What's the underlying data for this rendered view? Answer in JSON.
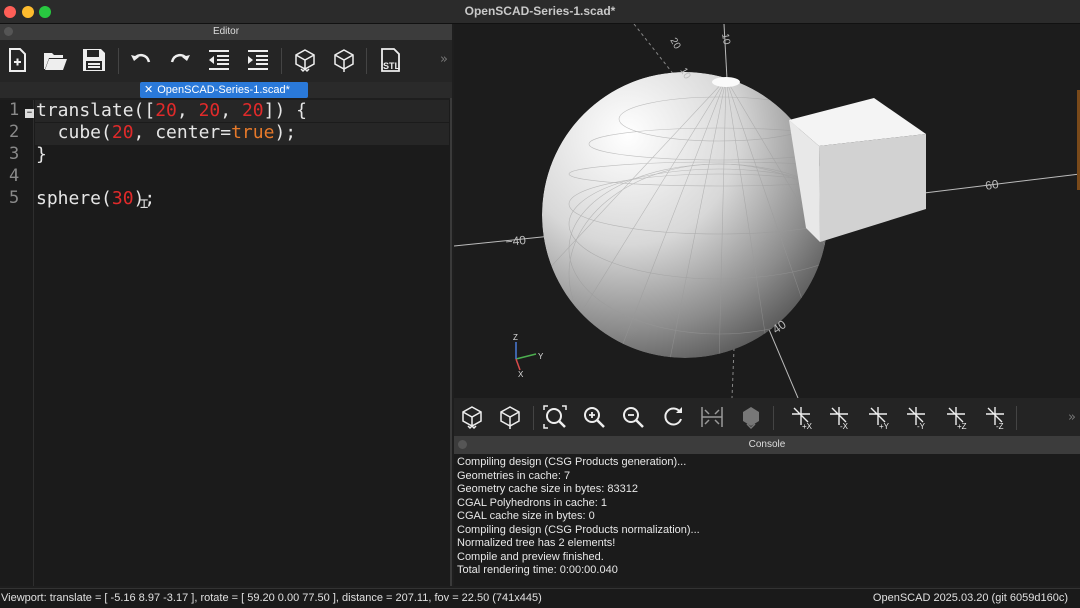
{
  "window": {
    "title": "OpenSCAD-Series-1.scad*"
  },
  "editor": {
    "header": "Editor",
    "tab_label": "OpenSCAD-Series-1.scad*",
    "more_glyph": "»",
    "toolbar_icons": [
      "new-file-icon",
      "open-file-icon",
      "save-icon",
      "undo-icon",
      "redo-icon",
      "unindent-icon",
      "indent-icon",
      "preview-icon",
      "render-icon",
      "export-stl-icon"
    ],
    "line_numbers": [
      "1",
      "2",
      "3",
      "4",
      "5"
    ]
  },
  "code": {
    "line1": {
      "a": "translate([",
      "n1": "20",
      "c1": ", ",
      "n2": "20",
      "c2": ", ",
      "n3": "20",
      "b": "]) {"
    },
    "line2": {
      "a": "  cube(",
      "n1": "20",
      "c1": ", center=",
      "kw": "true",
      "b": ");"
    },
    "line3": "}",
    "line5": {
      "a": "sphere(",
      "n1": "30",
      "b": ");"
    }
  },
  "viewport": {
    "axis_labels": [
      "60",
      "40",
      "40",
      "20",
      "10",
      "10"
    ],
    "neg_label": "−40",
    "gizmo": {
      "x": "X",
      "y": "Y",
      "z": "Z"
    }
  },
  "view_toolbar": {
    "icons": [
      "preview-icon",
      "render-icon",
      "view-all-icon",
      "zoom-in-icon",
      "zoom-out-icon",
      "reset-view-icon",
      "perspective-icon",
      "orthogonal-icon",
      "view-right-icon",
      "view-left-icon",
      "view-top-icon",
      "view-bottom-icon",
      "view-front-icon",
      "view-back-icon"
    ],
    "view_labels": [
      "+X",
      "-X",
      "+Y",
      "-Y",
      "+Z",
      "-Z"
    ],
    "more_glyph": "»"
  },
  "console": {
    "header": "Console",
    "lines": [
      "Compiling design (CSG Products generation)...",
      "Geometries in cache: 7",
      "Geometry cache size in bytes: 83312",
      "CGAL Polyhedrons in cache: 1",
      "CGAL cache size in bytes: 0",
      "Compiling design (CSG Products normalization)...",
      "Normalized tree has 2 elements!",
      "Compile and preview finished.",
      "Total rendering time: 0:00:00.040"
    ]
  },
  "status": {
    "viewport_info": "Viewport: translate = [ -5.16 8.97 -3.17 ], rotate = [ 59.20 0.00 77.50 ], distance = 207.11, fov = 22.50 (741x445)",
    "version": "OpenSCAD 2025.03.20 (git 6059d160c)"
  },
  "colors": {
    "accent": "#2a79d9",
    "number": "#e02a2a",
    "keyword": "#e6792a"
  }
}
